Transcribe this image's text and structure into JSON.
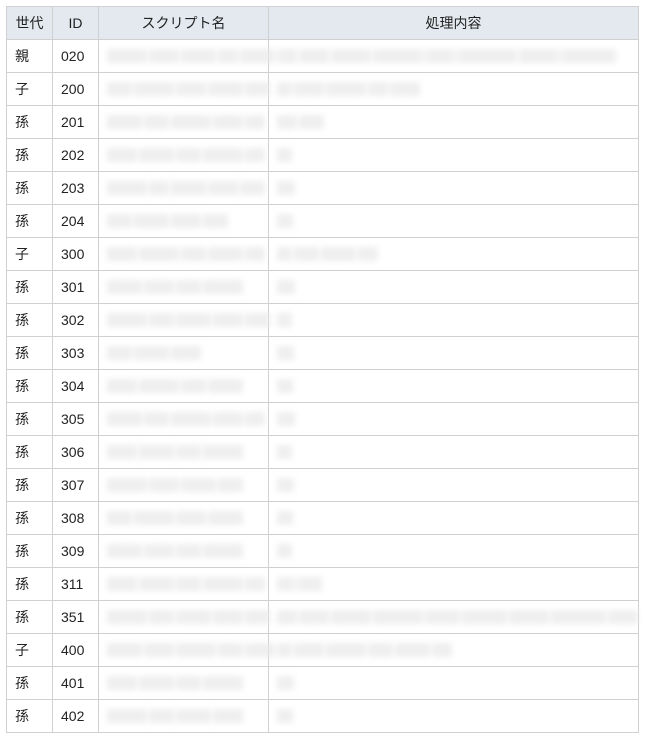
{
  "headers": {
    "generation": "世代",
    "id": "ID",
    "script_name": "スクリプト名",
    "process": "処理内容"
  },
  "rows": [
    {
      "generation": "親",
      "id": "020",
      "name_widths": [
        40,
        30,
        35,
        20,
        35
      ],
      "desc_widths": [
        20,
        30,
        40,
        50,
        30,
        60,
        40,
        55
      ]
    },
    {
      "generation": "子",
      "id": "200",
      "name_widths": [
        25,
        40,
        30,
        35,
        25
      ],
      "desc_widths": [
        15,
        30,
        40,
        20,
        30
      ]
    },
    {
      "generation": "孫",
      "id": "201",
      "name_widths": [
        35,
        25,
        40,
        30,
        20
      ],
      "desc_widths": [
        20,
        25
      ]
    },
    {
      "generation": "孫",
      "id": "202",
      "name_widths": [
        30,
        35,
        25,
        40,
        20
      ],
      "desc_widths": [
        15
      ]
    },
    {
      "generation": "孫",
      "id": "203",
      "name_widths": [
        40,
        20,
        35,
        30,
        25
      ],
      "desc_widths": [
        18
      ]
    },
    {
      "generation": "孫",
      "id": "204",
      "name_widths": [
        25,
        35,
        30,
        25
      ],
      "desc_widths": [
        16
      ]
    },
    {
      "generation": "子",
      "id": "300",
      "name_widths": [
        30,
        40,
        25,
        35,
        20
      ],
      "desc_widths": [
        15,
        25,
        35,
        20
      ]
    },
    {
      "generation": "孫",
      "id": "301",
      "name_widths": [
        35,
        30,
        25,
        40
      ],
      "desc_widths": [
        18
      ]
    },
    {
      "generation": "孫",
      "id": "302",
      "name_widths": [
        40,
        25,
        35,
        30,
        25
      ],
      "desc_widths": [
        15
      ]
    },
    {
      "generation": "孫",
      "id": "303",
      "name_widths": [
        25,
        35,
        30
      ],
      "desc_widths": [
        17
      ]
    },
    {
      "generation": "孫",
      "id": "304",
      "name_widths": [
        30,
        40,
        25,
        35
      ],
      "desc_widths": [
        16
      ]
    },
    {
      "generation": "孫",
      "id": "305",
      "name_widths": [
        35,
        25,
        40,
        30,
        20
      ],
      "desc_widths": [
        18
      ]
    },
    {
      "generation": "孫",
      "id": "306",
      "name_widths": [
        30,
        35,
        25,
        40
      ],
      "desc_widths": [
        15
      ]
    },
    {
      "generation": "孫",
      "id": "307",
      "name_widths": [
        40,
        30,
        35,
        25
      ],
      "desc_widths": [
        17
      ]
    },
    {
      "generation": "孫",
      "id": "308",
      "name_widths": [
        25,
        40,
        30,
        35
      ],
      "desc_widths": [
        16
      ]
    },
    {
      "generation": "孫",
      "id": "309",
      "name_widths": [
        35,
        30,
        25,
        40
      ],
      "desc_widths": [
        15
      ]
    },
    {
      "generation": "孫",
      "id": "311",
      "name_widths": [
        30,
        35,
        25,
        40,
        20
      ],
      "desc_widths": [
        18,
        25
      ]
    },
    {
      "generation": "孫",
      "id": "351",
      "name_widths": [
        40,
        25,
        35,
        30,
        25
      ],
      "desc_widths": [
        20,
        30,
        40,
        50,
        35,
        45,
        40,
        55,
        30
      ]
    },
    {
      "generation": "子",
      "id": "400",
      "name_widths": [
        35,
        30,
        40,
        25,
        30
      ],
      "desc_widths": [
        15,
        30,
        40,
        25,
        35,
        20
      ]
    },
    {
      "generation": "孫",
      "id": "401",
      "name_widths": [
        30,
        35,
        25,
        40
      ],
      "desc_widths": [
        17
      ]
    },
    {
      "generation": "孫",
      "id": "402",
      "name_widths": [
        40,
        25,
        35,
        30
      ],
      "desc_widths": [
        16
      ]
    }
  ]
}
